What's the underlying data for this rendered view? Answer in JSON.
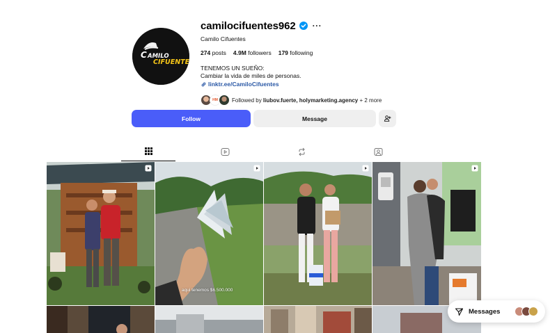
{
  "profile": {
    "username": "camilocifuentes962",
    "full_name": "Camilo Cifuentes",
    "verified": true,
    "logo_text": "CAMILO CIFUENTES",
    "stats": {
      "posts_value": "274",
      "posts_label": "posts",
      "followers_value": "4.9M",
      "followers_label": "followers",
      "following_value": "179",
      "following_label": "following"
    },
    "bio_line1": "TENEMOS UN SUEÑO:",
    "bio_line2": "Cambiar la vida de miles de personas.",
    "link": "linktr.ee/CamiloCifuentes",
    "followed_by_prefix": "Followed by",
    "followed_by_names": "liubov.fuerte, holymarketing.agency",
    "followed_by_more": "+ 2 more"
  },
  "actions": {
    "follow_label": "Follow",
    "message_label": "Message"
  },
  "tabs": [
    {
      "name": "posts",
      "icon": "grid-icon",
      "active": true
    },
    {
      "name": "reels",
      "icon": "reels-icon",
      "active": false
    },
    {
      "name": "reposts",
      "icon": "repost-icon",
      "active": false
    },
    {
      "name": "tagged",
      "icon": "tagged-icon",
      "active": false
    }
  ],
  "posts": [
    {
      "type": "reel",
      "scene": "two men at a wooden stall"
    },
    {
      "type": "reel",
      "scene": "hand holding banknotes",
      "caption": "aqui tenemos $6.500.000"
    },
    {
      "type": "reel",
      "scene": "two women holding box"
    },
    {
      "type": "reel",
      "scene": "hug by a door"
    }
  ],
  "messages": {
    "label": "Messages"
  },
  "colors": {
    "accent": "#4a5df9",
    "link": "#2b59a6",
    "verified": "#0095f6"
  }
}
